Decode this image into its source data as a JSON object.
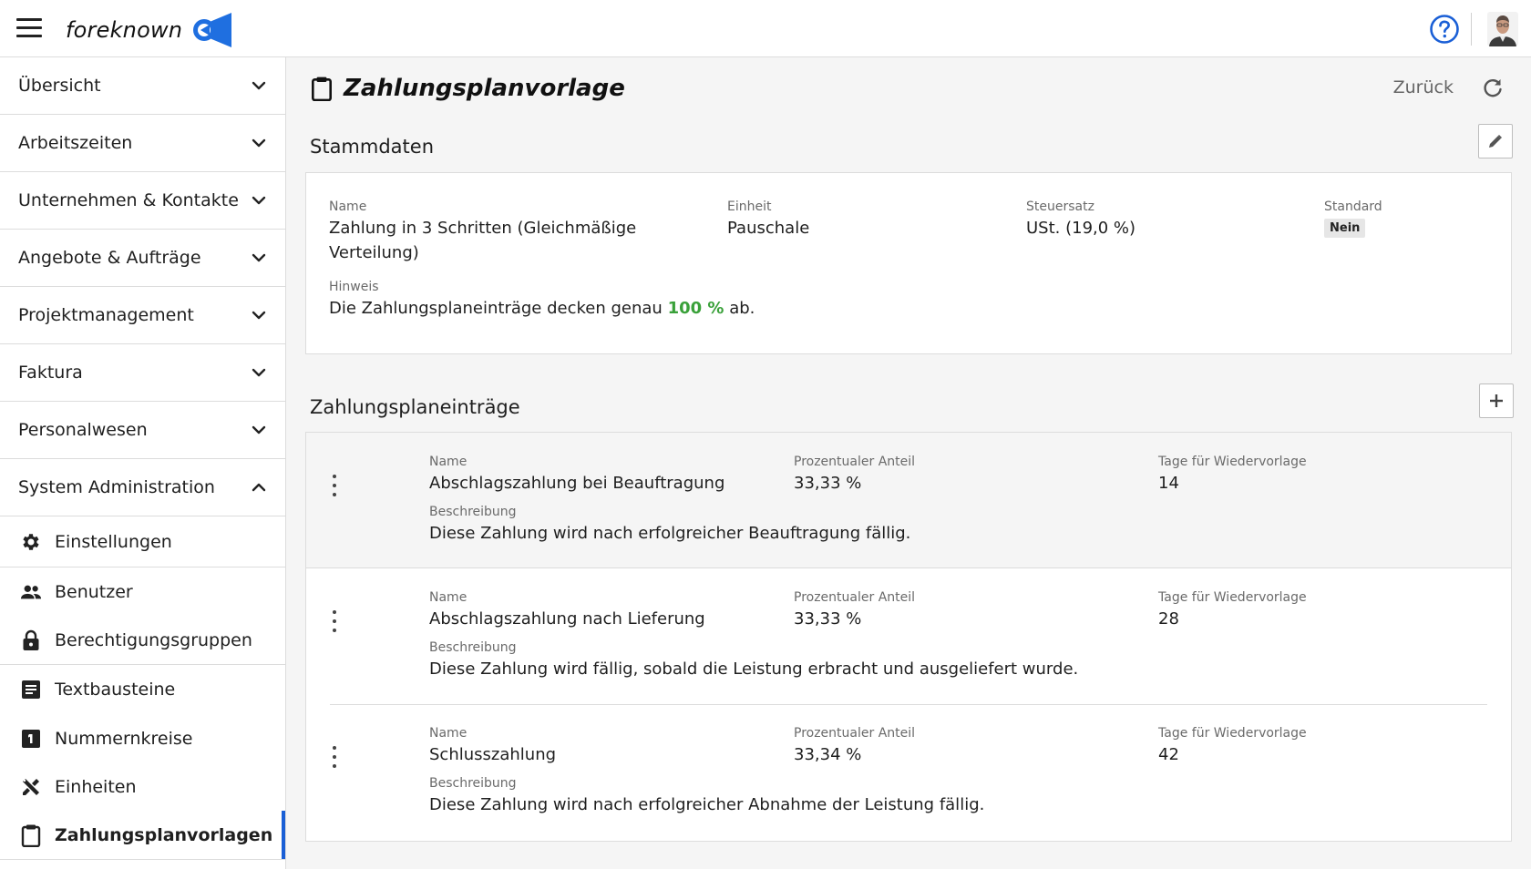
{
  "app": {
    "logo_text": "foreknown"
  },
  "sidebar": {
    "groups": [
      {
        "label": "Übersicht"
      },
      {
        "label": "Arbeitszeiten"
      },
      {
        "label": "Unternehmen & Kontakte"
      },
      {
        "label": "Angebote & Aufträge"
      },
      {
        "label": "Projektmanagement"
      },
      {
        "label": "Faktura"
      },
      {
        "label": "Personalwesen"
      },
      {
        "label": "System Administration"
      }
    ],
    "sub_items": [
      {
        "label": "Einstellungen",
        "icon": "gear-icon"
      },
      {
        "label": "Benutzer",
        "icon": "users-icon"
      },
      {
        "label": "Berechtigungsgruppen",
        "icon": "lock-icon"
      },
      {
        "label": "Textbausteine",
        "icon": "text-block-icon"
      },
      {
        "label": "Nummernkreise",
        "icon": "number-one-icon"
      },
      {
        "label": "Einheiten",
        "icon": "tools-icon"
      },
      {
        "label": "Zahlungsplanvorlagen",
        "icon": "clipboard-icon"
      }
    ],
    "active_item": "Zahlungsplanvorlagen"
  },
  "page": {
    "title": "Zahlungsplanvorlage",
    "back_label": "Zurück"
  },
  "stammdaten": {
    "title": "Stammdaten",
    "name_label": "Name",
    "name_value": "Zahlung in 3 Schritten (Gleichmäßige Verteilung)",
    "einheit_label": "Einheit",
    "einheit_value": "Pauschale",
    "steuersatz_label": "Steuersatz",
    "steuersatz_value": "USt. (19,0 %)",
    "standard_label": "Standard",
    "standard_value": "Nein",
    "hinweis_label": "Hinweis",
    "hinweis_prefix": "Die Zahlungsplaneinträge decken genau",
    "hinweis_percent": "100 %",
    "hinweis_suffix": "ab."
  },
  "entries_section": {
    "title": "Zahlungsplaneinträge",
    "name_label": "Name",
    "anteil_label": "Prozentualer Anteil",
    "tage_label": "Tage für Wiedervorlage",
    "beschreibung_label": "Beschreibung",
    "entries": [
      {
        "name": "Abschlagszahlung bei Beauftragung",
        "anteil": "33,33 %",
        "tage": "14",
        "beschreibung": "Diese Zahlung wird nach erfolgreicher Beauftragung fällig."
      },
      {
        "name": "Abschlagszahlung nach Lieferung",
        "anteil": "33,33 %",
        "tage": "28",
        "beschreibung": "Diese Zahlung wird fällig, sobald die Leistung erbracht und ausgeliefert wurde."
      },
      {
        "name": "Schlusszahlung",
        "anteil": "33,34 %",
        "tage": "42",
        "beschreibung": "Diese Zahlung wird nach erfolgreicher Abnahme der Leistung fällig."
      }
    ]
  },
  "colors": {
    "accent": "#1a5fd6",
    "success": "#3aa13a",
    "logo_blue": "#1f6fe0"
  }
}
